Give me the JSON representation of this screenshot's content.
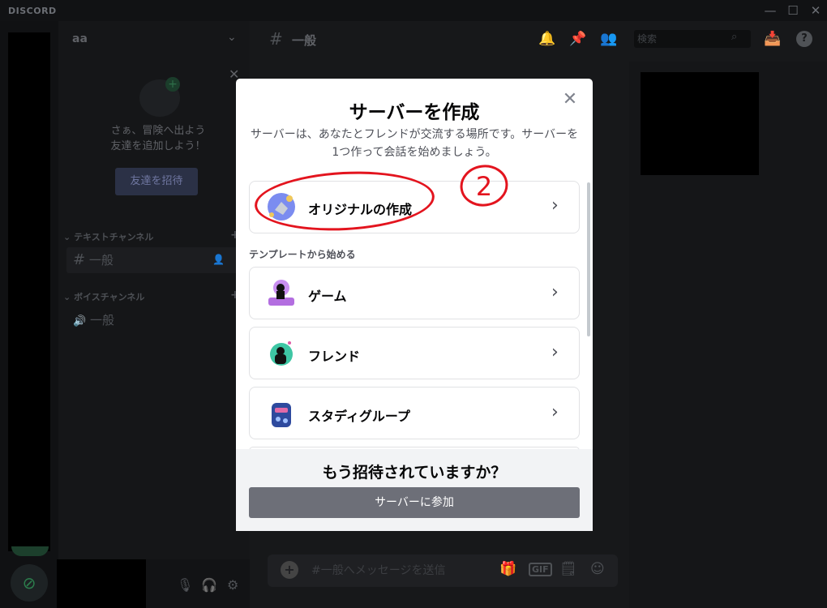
{
  "window": {
    "brand": "DISCORD",
    "minimize": "—",
    "maximize": "☐",
    "close": "✕"
  },
  "server": {
    "name": "aa",
    "chevron": "⌄"
  },
  "invite_card": {
    "close": "✕",
    "text": "さぁ、冒険へ出よう\n友達を追加しよう！",
    "button": "友達を招待"
  },
  "channels": {
    "text_category": "テキストチャンネル",
    "text_channel": "一般",
    "voice_category": "ボイスチャンネル",
    "voice_channel": "一般"
  },
  "header": {
    "channel_name": "一般",
    "search_placeholder": "検索"
  },
  "composer": {
    "placeholder": "#一般へメッセージを送信",
    "gif": "GIF"
  },
  "modal": {
    "title": "サーバーを作成",
    "subtitle": "サーバーは、あなたとフレンドが交流する場所です。サーバーを1つ作って会話を始めましょう。",
    "create_own": "オリジナルの作成",
    "templates_heading": "テンプレートから始める",
    "templates": [
      "ゲーム",
      "フレンド",
      "スタディグループ"
    ],
    "footer_title": "もう招待されていますか？",
    "join_button": "サーバーに参加",
    "close": "✕",
    "chevron": "›"
  },
  "annotation": {
    "number": "2",
    "color": "#e3141e"
  },
  "colors": {
    "accent": "#5865f2",
    "join_button": "#6d6f78"
  }
}
